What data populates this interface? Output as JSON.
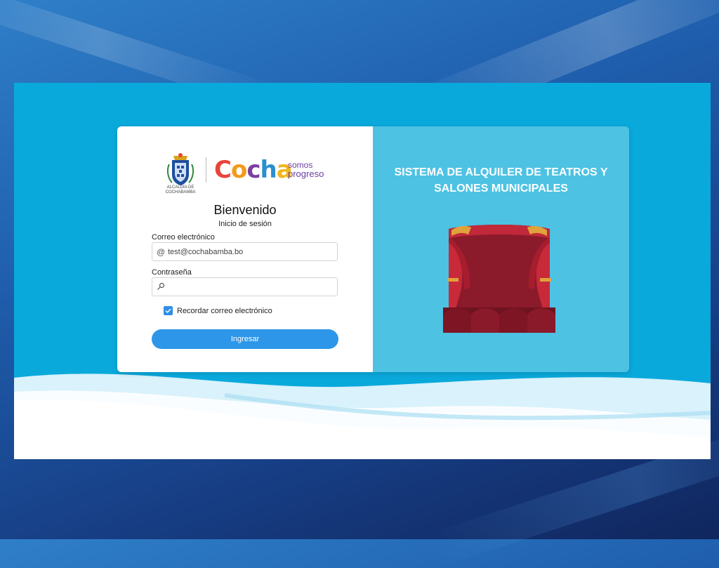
{
  "login": {
    "welcome": "Bienvenido",
    "subtitle": "Inicio de sesión",
    "email_label": "Correo electrónico",
    "email_value": "test@cochabamba.bo",
    "password_label": "Contraseña",
    "password_value": "",
    "remember_label": "Recordar correo electrónico",
    "remember_checked": true,
    "submit_label": "Ingresar"
  },
  "logo": {
    "alcaldia_line1": "ALCALDÍA DE",
    "alcaldia_line2": "COCHABAMBA",
    "brand": "Cocha",
    "brand_letters": [
      "C",
      "o",
      "c",
      "h",
      "a"
    ],
    "tagline_top": "somos",
    "tagline_bottom": "progreso"
  },
  "promo": {
    "title": "SISTEMA DE ALQUILER DE TEATROS Y SALONES MUNICIPALES",
    "image_icon": "theater-stage-icon"
  },
  "icons": {
    "email_field_icon": "at-sign-icon",
    "password_field_icon": "key-icon",
    "checkbox_icon": "check-icon"
  },
  "colors": {
    "page_background": "#0aa9dc",
    "promo_background": "#4dc2e3",
    "primary_button": "#2d96e8",
    "checkbox": "#2d8fe8",
    "curtain_red": "#b3202c"
  }
}
